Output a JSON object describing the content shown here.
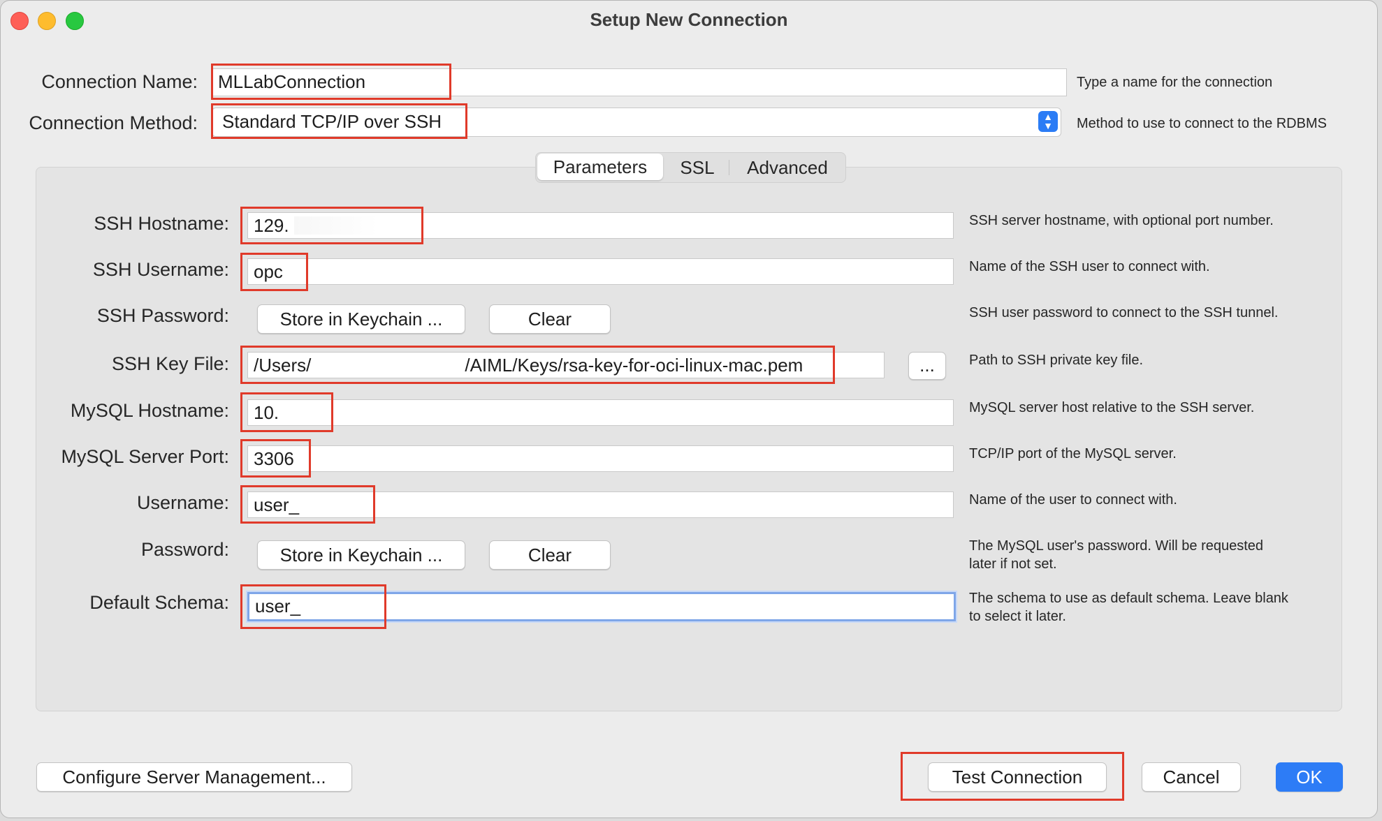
{
  "window": {
    "title": "Setup New Connection"
  },
  "connection": {
    "name_label": "Connection Name:",
    "name_value": "MLLabConnection",
    "name_hint": "Type a name for the connection",
    "method_label": "Connection Method:",
    "method_value": "Standard TCP/IP over SSH",
    "method_hint": "Method to use to connect to the RDBMS"
  },
  "tabs": [
    "Parameters",
    "SSL",
    "Advanced"
  ],
  "params": {
    "ssh_hostname": {
      "label": "SSH Hostname:",
      "value": "129.",
      "hint": "SSH server hostname, with  optional port number."
    },
    "ssh_username": {
      "label": "SSH Username:",
      "value": "opc",
      "hint": "Name of the SSH user to connect with."
    },
    "ssh_password": {
      "label": "SSH Password:",
      "store": "Store in Keychain ...",
      "clear": "Clear",
      "hint": "SSH user password to connect to the SSH tunnel."
    },
    "ssh_keyfile": {
      "label": "SSH Key File:",
      "value_start": "/Users/",
      "value_end": "/AIML/Keys/rsa-key-for-oci-linux-mac.pem",
      "browse": "...",
      "hint": "Path to SSH private key file."
    },
    "mysql_hostname": {
      "label": "MySQL Hostname:",
      "value": "10.",
      "hint": "MySQL server host relative to the SSH server."
    },
    "mysql_port": {
      "label": "MySQL Server Port:",
      "value": "3306",
      "hint": "TCP/IP port of the MySQL server."
    },
    "username": {
      "label": "Username:",
      "value": "user_",
      "hint": "Name of the user to connect with."
    },
    "password": {
      "label": "Password:",
      "store": "Store in Keychain ...",
      "clear": "Clear",
      "hint_line1": "The MySQL user's password. Will be requested",
      "hint_line2": "later if not set."
    },
    "default_schema": {
      "label": "Default Schema:",
      "value": "user_",
      "hint_line1": "The schema to use as default schema. Leave blank",
      "hint_line2": "to select it later."
    }
  },
  "footer": {
    "configure": "Configure Server Management...",
    "test": "Test Connection",
    "cancel": "Cancel",
    "ok": "OK"
  },
  "colors": {
    "highlight": "#e03a2a",
    "accent": "#2d7cf6",
    "focus": "#7fa6e8"
  }
}
